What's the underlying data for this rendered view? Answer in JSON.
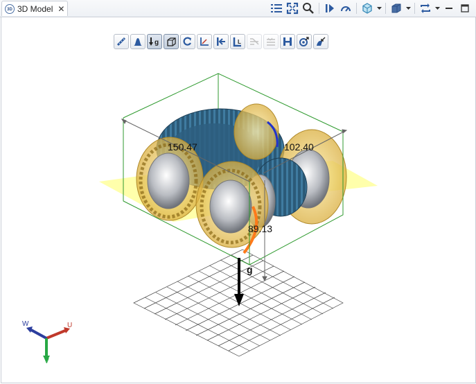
{
  "tab": {
    "title": "3D Model",
    "icon": "3d-model-icon",
    "close": "✕",
    "badge": "3D"
  },
  "toolbar": {
    "icons": [
      "list-icon",
      "fit-view-icon",
      "zoom-icon",
      "play-icon",
      "speed-gauge-icon",
      "render-style-icon",
      "shading-icon",
      "sync-icon",
      "minimize-icon",
      "maximize-icon"
    ]
  },
  "view_tools": [
    {
      "name": "measure-icon",
      "state": "normal"
    },
    {
      "name": "load-profile-icon",
      "state": "normal"
    },
    {
      "name": "gravity-icon",
      "state": "active",
      "text": "g"
    },
    {
      "name": "bounding-box-icon",
      "state": "active"
    },
    {
      "name": "rotate-icon",
      "state": "normal"
    },
    {
      "name": "axes-icon",
      "state": "normal"
    },
    {
      "name": "arrow-left-icon",
      "state": "normal"
    },
    {
      "name": "corner-icon",
      "state": "normal",
      "text": "L"
    },
    {
      "name": "deflection-icon",
      "state": "disabled"
    },
    {
      "name": "stress-icon",
      "state": "disabled"
    },
    {
      "name": "shaft-icon",
      "state": "normal",
      "text": "H"
    },
    {
      "name": "bearing-icon",
      "state": "normal"
    },
    {
      "name": "export-icon",
      "state": "normal"
    }
  ],
  "dimensions": {
    "d1": "150.47",
    "d2": "102.40",
    "d3": "89.13"
  },
  "gravity_label": "g",
  "triad": {
    "w": "W",
    "u": "U",
    "v": "V"
  },
  "colors": {
    "box": "#2f9a2f",
    "gear": "#2b5a78",
    "bearing": "#e0c25a",
    "plane": "#ffff66",
    "gravity": "#000000",
    "triad_u": "#c0392b",
    "triad_w": "#2c3e9e",
    "triad_v": "#27a844"
  }
}
